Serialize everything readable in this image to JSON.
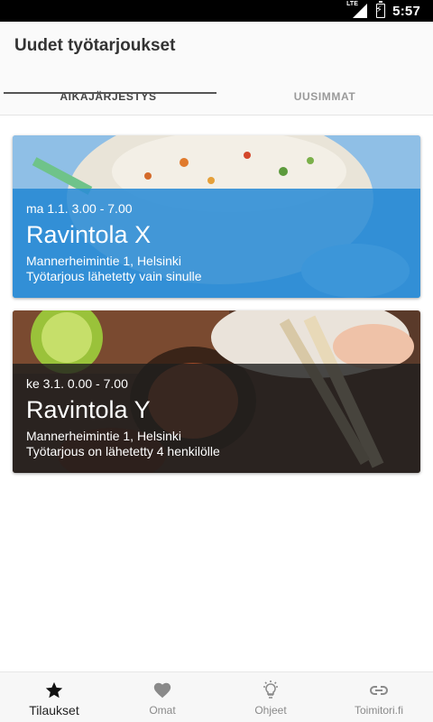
{
  "status_bar": {
    "network": "LTE",
    "time": "5:57"
  },
  "app_bar": {
    "title": "Uudet työtarjoukset"
  },
  "tabs": [
    {
      "label": "AIKAJÄRJESTYS",
      "active": true
    },
    {
      "label": "UUSIMMAT",
      "active": false
    }
  ],
  "cards": [
    {
      "time": "ma 1.1. 3.00 - 7.00",
      "name": "Ravintola X",
      "address": "Mannerheimintie 1, Helsinki",
      "note": "Työtarjous lähetetty vain sinulle",
      "overlay_color": "#2a8cd6",
      "image": "fried-rice-photo"
    },
    {
      "time": "ke 3.1. 0.00 - 7.00",
      "name": "Ravintola Y",
      "address": "Mannerheimintie 1, Helsinki",
      "note": "Työtarjous on lähetetty 4 henkilölle",
      "overlay_color": "#1e1e1e",
      "image": "asian-dishes-photo"
    }
  ],
  "bottom_nav": [
    {
      "label": "Tilaukset",
      "icon": "star-icon",
      "active": true
    },
    {
      "label": "Omat",
      "icon": "heart-icon",
      "active": false
    },
    {
      "label": "Ohjeet",
      "icon": "lightbulb-icon",
      "active": false
    },
    {
      "label": "Toimitori.fi",
      "icon": "link-icon",
      "active": false
    }
  ]
}
